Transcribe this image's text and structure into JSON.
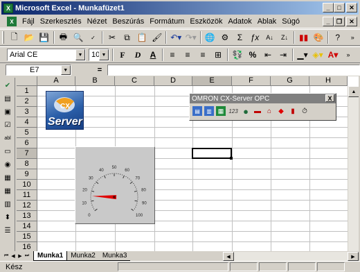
{
  "window": {
    "title": "Microsoft Excel - Munkafüzet1"
  },
  "menu": {
    "items": [
      "Fájl",
      "Szerkesztés",
      "Nézet",
      "Beszúrás",
      "Formátum",
      "Eszközök",
      "Adatok",
      "Ablak",
      "Súgó"
    ]
  },
  "format_toolbar": {
    "font": "Arial CE",
    "size": "10"
  },
  "formula_bar": {
    "name_box": "E7",
    "equals": "="
  },
  "sheet": {
    "columns": [
      "A",
      "B",
      "C",
      "D",
      "E",
      "F",
      "G",
      "H"
    ],
    "rows": [
      "1",
      "2",
      "3",
      "4",
      "5",
      "6",
      "7",
      "8",
      "9",
      "10",
      "11",
      "12",
      "13",
      "14",
      "15",
      "16"
    ],
    "selected_cell": "E7"
  },
  "logo": {
    "text": "Server",
    "mark": "CX"
  },
  "gauge": {
    "ticks": [
      "0",
      "10",
      "20",
      "30",
      "40",
      "50",
      "60",
      "70",
      "80",
      "90",
      "100"
    ],
    "value": 15
  },
  "opc_toolbar": {
    "title": "OMRON CX-Server OPC",
    "close": "X",
    "num_icon": "123"
  },
  "tabs": {
    "items": [
      "Munka1",
      "Munka2",
      "Munka3"
    ],
    "active": "Munka1"
  },
  "status": {
    "text": "Kész"
  },
  "colors": {
    "title_start": "#0a246a",
    "title_end": "#a6caf0",
    "gauge_needle": "#e00000"
  }
}
